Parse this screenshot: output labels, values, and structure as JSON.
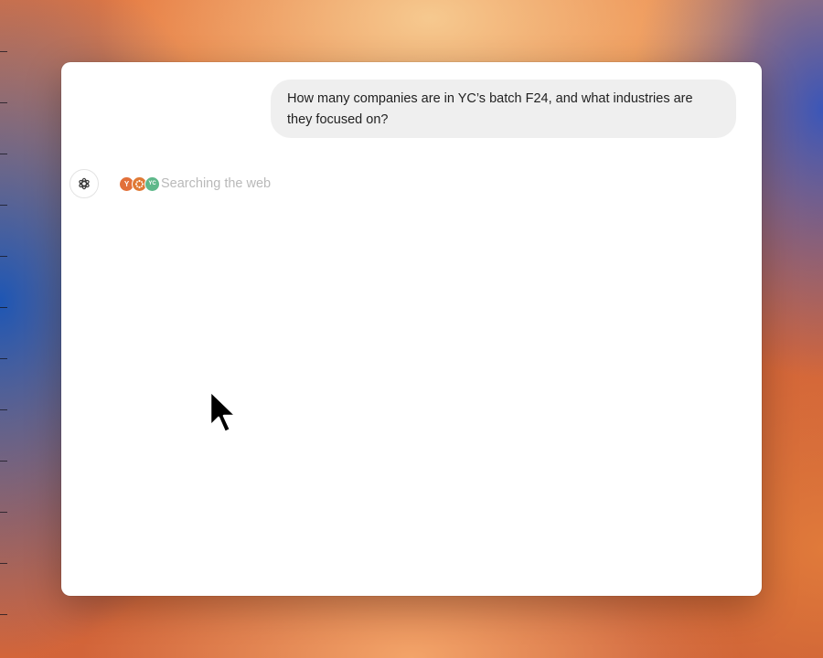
{
  "conversation": {
    "user_message": "How many companies are in YC’s batch F24, and what industries are they focused on?",
    "assistant_status": "Searching the web",
    "source_favicons": [
      {
        "name": "y-combinator-favicon",
        "glyph": "Y",
        "color": "#e2703a"
      },
      {
        "name": "dots-favicon",
        "glyph": "",
        "color": "#e07a35"
      },
      {
        "name": "green-favicon",
        "glyph": "YC",
        "color": "#5eb88a"
      }
    ]
  }
}
